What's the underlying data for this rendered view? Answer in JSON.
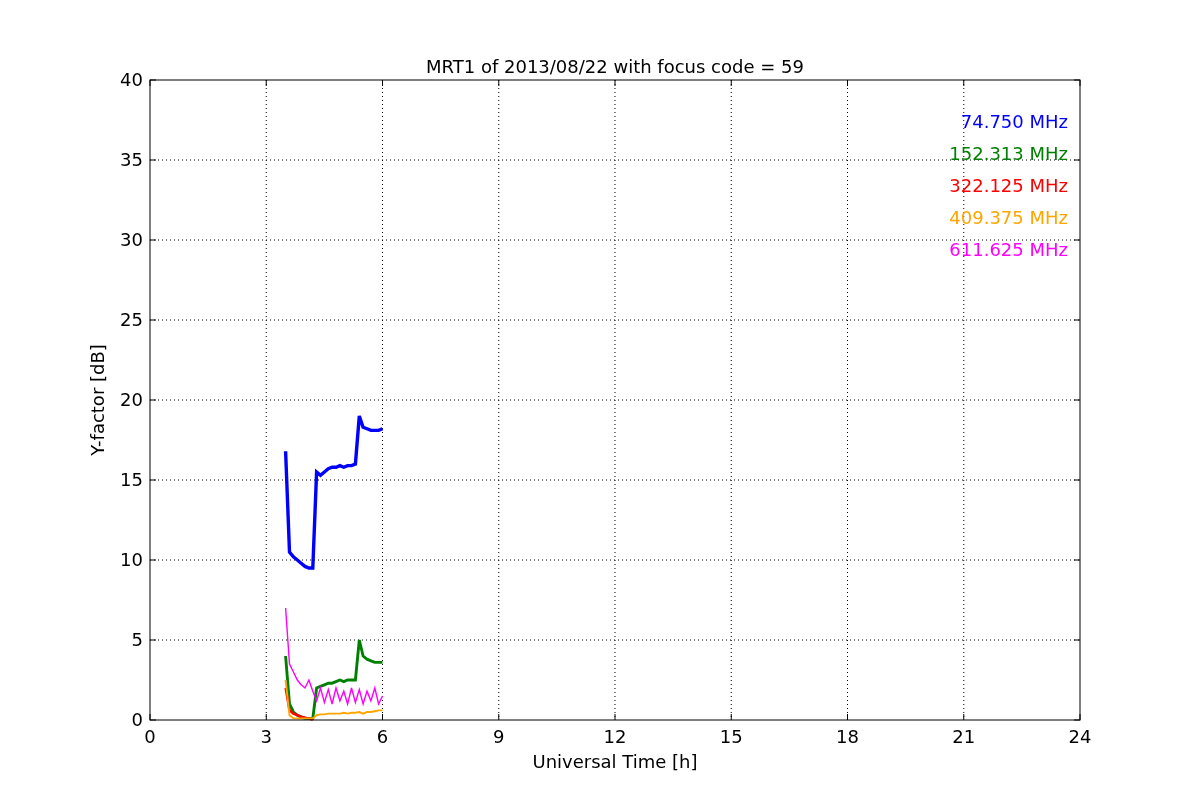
{
  "figure": {
    "chart_data": {
      "type": "line",
      "title": "MRT1 of 2013/08/22 with focus code = 59",
      "xlabel": "Universal Time [h]",
      "ylabel": "Y-factor [dB]",
      "x": [
        3.5,
        3.6,
        3.7,
        3.8,
        3.9,
        4.0,
        4.1,
        4.2,
        4.3,
        4.4,
        4.5,
        4.6,
        4.7,
        4.8,
        4.9,
        5.0,
        5.1,
        5.2,
        5.3,
        5.4,
        5.5,
        5.6,
        5.7,
        5.8,
        5.9,
        6.0
      ],
      "series": [
        {
          "name": "74.750 MHz",
          "color": "#0000ff",
          "values": [
            16.8,
            10.5,
            10.2,
            10.0,
            9.8,
            9.6,
            9.5,
            9.5,
            15.5,
            15.3,
            15.5,
            15.7,
            15.8,
            15.8,
            15.9,
            15.8,
            15.9,
            15.9,
            16.0,
            19.0,
            18.3,
            18.2,
            18.1,
            18.1,
            18.1,
            18.2
          ]
        },
        {
          "name": "152.313 MHz",
          "color": "#008000",
          "values": [
            4.0,
            1.0,
            0.5,
            0.3,
            0.2,
            0.1,
            0.1,
            0.1,
            2.0,
            2.1,
            2.2,
            2.3,
            2.3,
            2.4,
            2.5,
            2.4,
            2.5,
            2.5,
            2.5,
            5.0,
            4.0,
            3.8,
            3.7,
            3.6,
            3.6,
            3.6
          ]
        },
        {
          "name": "322.125 MHz",
          "color": "#ff0000",
          "values": [
            2.0,
            0.6,
            0.4,
            0.3,
            0.2,
            0.15,
            0.1,
            0.0,
            null,
            null,
            null,
            null,
            null,
            null,
            null,
            null,
            null,
            null,
            null,
            null,
            null,
            null,
            null,
            null,
            null,
            null
          ]
        },
        {
          "name": "409.375 MHz",
          "color": "#ffa500",
          "values": [
            2.5,
            0.3,
            0.1,
            0.1,
            0.1,
            0.1,
            0.1,
            0.1,
            0.3,
            0.35,
            0.35,
            0.4,
            0.4,
            0.4,
            0.4,
            0.45,
            0.4,
            0.45,
            0.45,
            0.5,
            0.4,
            0.5,
            0.5,
            0.55,
            0.6,
            0.6
          ]
        },
        {
          "name": "611.625 MHz",
          "color": "#ff00ff",
          "values": [
            7.0,
            3.5,
            3.0,
            2.5,
            2.2,
            2.0,
            2.5,
            1.8,
            1.2,
            2.0,
            1.1,
            1.9,
            1.0,
            2.0,
            1.2,
            1.8,
            1.0,
            2.0,
            1.1,
            1.9,
            1.0,
            1.8,
            1.2,
            2.0,
            1.0,
            1.5
          ]
        }
      ],
      "grid": true,
      "xlim": [
        0,
        24
      ],
      "ylim": [
        0,
        40
      ],
      "xticks": [
        0,
        3,
        6,
        9,
        12,
        15,
        18,
        21,
        24
      ],
      "yticks": [
        0,
        5,
        10,
        15,
        20,
        25,
        30,
        35,
        40
      ]
    }
  }
}
